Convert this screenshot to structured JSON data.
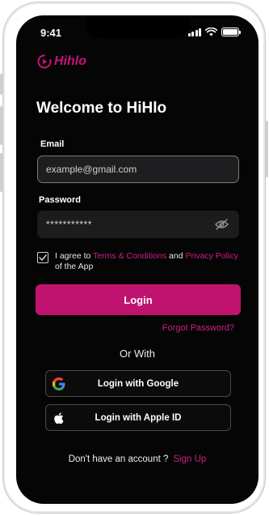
{
  "status_bar": {
    "time": "9:41"
  },
  "brand": {
    "name": "Hihlo",
    "color": "#c7127a"
  },
  "welcome_title": "Welcome to HiHlo",
  "email": {
    "label": "Email",
    "placeholder": "example@gmail.com"
  },
  "password": {
    "label": "Password",
    "value": "***********"
  },
  "terms": {
    "prefix": "I agree to ",
    "terms_link": "Terms & Conditions",
    "and": " and ",
    "privacy_link": "Privacy Policy",
    "suffix": " of the App",
    "checked": true
  },
  "login_button": "Login",
  "forgot_password": "Forgot Password?",
  "or_with": "Or With",
  "social": {
    "google": {
      "label": "Login with Google",
      "icon": "google-icon"
    },
    "apple": {
      "label": "Login with Apple ID",
      "icon": "apple-icon"
    }
  },
  "signup": {
    "prompt": "Don't have an account ?",
    "link": "Sign Up"
  },
  "colors": {
    "accent": "#c0136f",
    "link": "#d01f87",
    "background": "#050505"
  }
}
